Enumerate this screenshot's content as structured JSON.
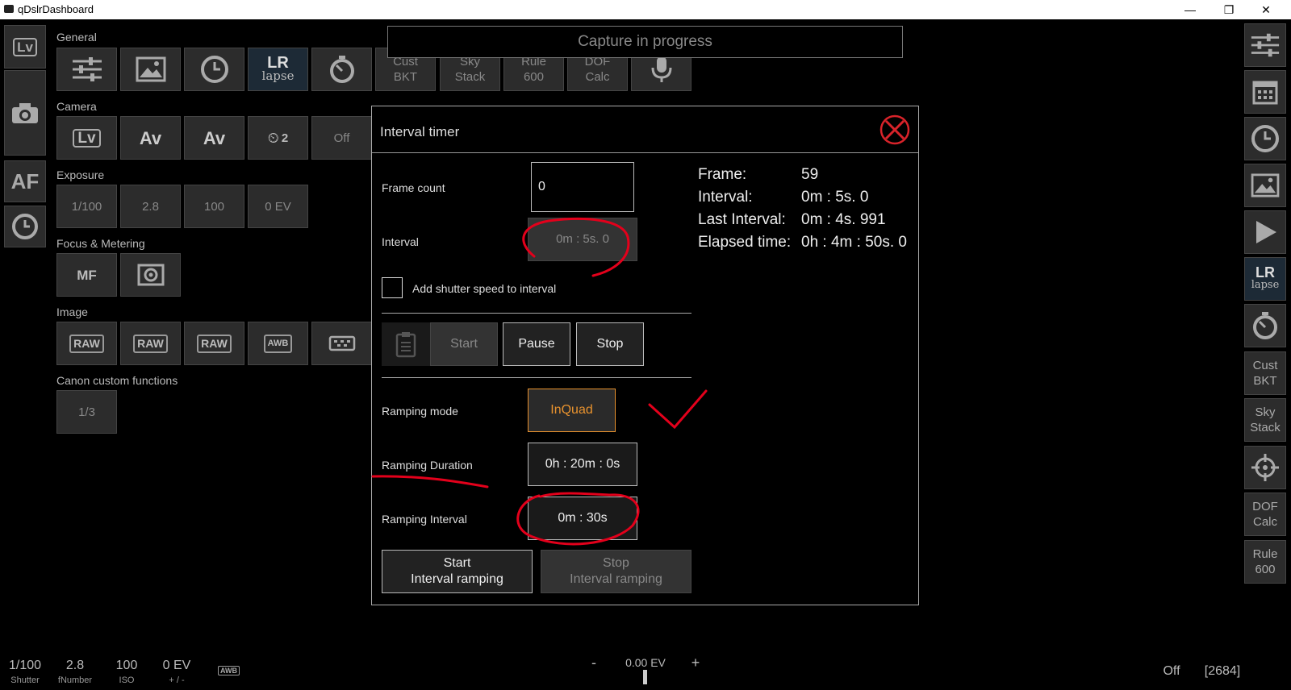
{
  "window": {
    "title": "qDslrDashboard",
    "minimize": "—",
    "restore": "❐",
    "close": "✕"
  },
  "banner": {
    "text": "Capture in progress"
  },
  "left_rail": {
    "lv": "Lv",
    "af": "AF"
  },
  "sections": {
    "general": {
      "label": "General",
      "tiles": [
        "Cust\nBKT",
        "Sky\nStack",
        "Rule\n600",
        "DOF\nCalc"
      ],
      "lr_a": "LR",
      "lr_b": "lapse"
    },
    "camera": {
      "label": "Camera",
      "tiles": [
        "Lv",
        "Av",
        "Av",
        "2",
        "Off"
      ]
    },
    "exposure": {
      "label": "Exposure",
      "tiles": [
        "1/100",
        "2.8",
        "100",
        "0 EV"
      ]
    },
    "focus": {
      "label": "Focus & Metering",
      "tiles": [
        "MF"
      ]
    },
    "image": {
      "label": "Image",
      "tiles": [
        "RAW",
        "RAW",
        "RAW",
        "AWB"
      ]
    },
    "custom": {
      "label": "Canon custom functions",
      "tiles": [
        "1/3"
      ]
    }
  },
  "right_rail": {
    "lr_a": "LR",
    "lr_b": "lapse",
    "tiles": [
      "Cust\nBKT",
      "Sky\nStack",
      "DOF\nCalc",
      "Rule\n600"
    ]
  },
  "dialog": {
    "title": "Interval timer",
    "frame_count": {
      "label": "Frame count",
      "value": "0"
    },
    "interval": {
      "label": "Interval",
      "value": "0m : 5s. 0"
    },
    "add_shutter": {
      "label": "Add shutter speed to interval",
      "checked": false
    },
    "start": "Start",
    "pause": "Pause",
    "stop": "Stop",
    "ramping_mode": {
      "label": "Ramping mode",
      "value": "InQuad"
    },
    "ramping_duration": {
      "label": "Ramping Duration",
      "value": "0h : 20m : 0s"
    },
    "ramping_interval": {
      "label": "Ramping Interval",
      "value": "0m : 30s"
    },
    "start_ramping": "Start\nInterval ramping",
    "stop_ramping": "Stop\nInterval ramping",
    "info": [
      {
        "key": "Frame:",
        "value": "59"
      },
      {
        "key": "Interval:",
        "value": "0m : 5s. 0"
      },
      {
        "key": "Last Interval:",
        "value": "0m : 4s. 991"
      },
      {
        "key": "Elapsed time:",
        "value": "0h : 4m : 50s. 0"
      }
    ]
  },
  "bottom": {
    "shutter": {
      "value": "1/100",
      "caption": "Shutter"
    },
    "fnumber": {
      "value": "2.8",
      "caption": "fNumber"
    },
    "iso": {
      "value": "100",
      "caption": "ISO"
    },
    "ev": {
      "value": "0 EV",
      "caption": "+ / -"
    },
    "awb": "AWB",
    "ev_minus": "-",
    "ev_center": "0.00 EV",
    "ev_plus": "+",
    "status": "Off",
    "count": "[2684]"
  },
  "colors": {
    "accent_orange": "#e8922e",
    "annotation_red": "#e3001b",
    "close_red": "#d8232a"
  }
}
